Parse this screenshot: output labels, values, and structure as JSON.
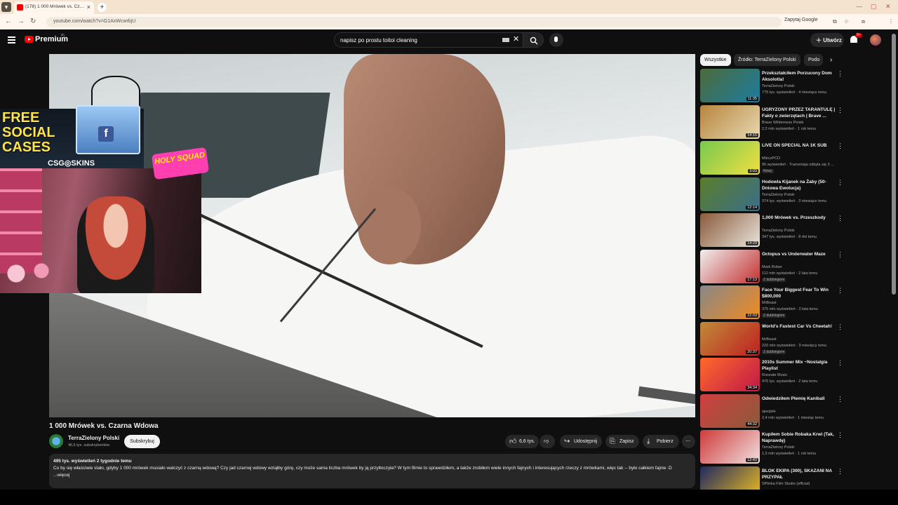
{
  "browser": {
    "tab_title": "(178) 1 000 Mrówek vs. Cz…",
    "url": "youtube.com/watch?v=G1AxWcwrbjU",
    "translate_label": "Zapytaj Google"
  },
  "header": {
    "brand": "Premium",
    "region": "PL",
    "search_value": "napisz po prostu toitoi cleaning",
    "create_label": "Utwórz",
    "notif_count": "9+"
  },
  "overlay": {
    "promo_text": "FREE SOCIAL CASES",
    "promo_brand": "CSG◎SKINS",
    "sticker": "HOLY SQUAD"
  },
  "video": {
    "title": "1 000 Mrówek vs. Czarna Wdowa",
    "channel": "TerraZielony Polski",
    "subs": "46,6 tys. subskrybentów",
    "subscribe_label": "Subskrybuj",
    "likes": "6,6 tys.",
    "share_label": "Udostępnij",
    "save_label": "Zapisz",
    "download_label": "Pobierz",
    "views_date": "495 tys. wyświetleń  2 tygodnie temu",
    "description": "Co by się właściwie stało, gdyby 1 000 mrówek musiało walczyć z czarną wdową? Czy jad czarnej wdowy wziąłby górę, czy może sama liczba mrówek by ją przytłoczyła? W tym filmie to sprawdziłem, a także zrobiłem wiele innych fajnych i interesujących rzeczy z mrówkami, więc tak -- było całkiem fajnie :D",
    "more_label": "...więcej"
  },
  "chips": [
    "Wszystkie",
    "Źródło: TerraZielony Polski",
    "Podo"
  ],
  "recommendations": [
    {
      "title": "Przekształciłem Porzucony Dom Aksolotla!",
      "channel": "TerraZielony Polski",
      "meta": "775 tys. wyświetleń · 4 miesiące temu",
      "duration": "11:35",
      "badge": "",
      "colors": [
        "#4d6a3a",
        "#1b7da0"
      ]
    },
    {
      "title": "UGRYZONY PRZEZ TARANTULĘ | Fakty o zwierzętach | Brave ...",
      "channel": "Brave Wilderness Polski",
      "meta": "2,2 mln wyświetleń · 1 rok temu",
      "duration": "14:15",
      "badge": "",
      "colors": [
        "#b7853f",
        "#e7d9b0"
      ]
    },
    {
      "title": "LIVE ON SPECIAL NA 1K SUB",
      "channel": "MleczPCD",
      "meta": "95 wyświetleń · Transmisja odbyła się 3 ...",
      "duration": "3:03",
      "badge": "Nowy",
      "colors": [
        "#78c850",
        "#f0e040"
      ]
    },
    {
      "title": "Hodowla Kijanek na Żaby (50-Dniowa Ewolucja)",
      "channel": "TerraZielony Polski",
      "meta": "374 tys. wyświetleń · 3 miesiące temu",
      "duration": "12:14",
      "badge": "",
      "colors": [
        "#5a7d2a",
        "#3b6e8a"
      ]
    },
    {
      "title": "1,000 Mrówek vs. Przeszkody",
      "channel": "TerraZielony Polski",
      "meta": "347 tys. wyświetleń · 8 dni temu",
      "duration": "14:29",
      "badge": "",
      "colors": [
        "#8a5a3a",
        "#e9e4dc"
      ]
    },
    {
      "title": "Octopus vs Underwater Maze",
      "channel": "Mark Rober",
      "meta": "112 mln wyświetleń · 2 lata temu",
      "duration": "17:13",
      "badge": "Z dubbingiem",
      "colors": [
        "#f0f0f0",
        "#c43030"
      ]
    },
    {
      "title": "Face Your Biggest Fear To Win $800,000",
      "channel": "MrBeast",
      "meta": "375 mln wyświetleń · 2 lata temu",
      "duration": "22:03",
      "badge": "Z dubbingiem",
      "colors": [
        "#888888",
        "#f08a20"
      ]
    },
    {
      "title": "World's Fastest Car Vs Cheetah!",
      "channel": "MrBeast",
      "meta": "220 mln wyświetleń · 9 miesięcy temu",
      "duration": "20:37",
      "badge": "Z dubbingiem",
      "colors": [
        "#c08a3a",
        "#c02020"
      ]
    },
    {
      "title": "2010s Summer Mix ~Nostalgia Playlist",
      "channel": "Roseate Music",
      "meta": "476 tys. wyświetleń · 2 lata temu",
      "duration": "34:34",
      "badge": "",
      "colors": [
        "#ff6a2a",
        "#c01848"
      ]
    },
    {
      "title": "Odwiedziłem Plemię Kanibali",
      "channel": "ojwojtek",
      "meta": "2,4 mln wyświetleń · 1 miesiąc temu",
      "duration": "44:32",
      "badge": "",
      "colors": [
        "#d04040",
        "#8a5a3a"
      ]
    },
    {
      "title": "Kupiłem Sobie Robaka Krwi (Tak, Naprawdę)",
      "channel": "TerraZielony Polski",
      "meta": "1,5 mln wyświetleń · 1 rok temu",
      "duration": "12:42",
      "badge": "",
      "colors": [
        "#d03a3a",
        "#f0e0e0"
      ]
    },
    {
      "title": "BLOK EKIPA (300), SKAZANI NA PRZYPAŁ",
      "channel": "SPlinka Film Studio (official)",
      "meta": "",
      "duration": "",
      "badge": "",
      "colors": [
        "#202860",
        "#f0c020"
      ]
    }
  ]
}
